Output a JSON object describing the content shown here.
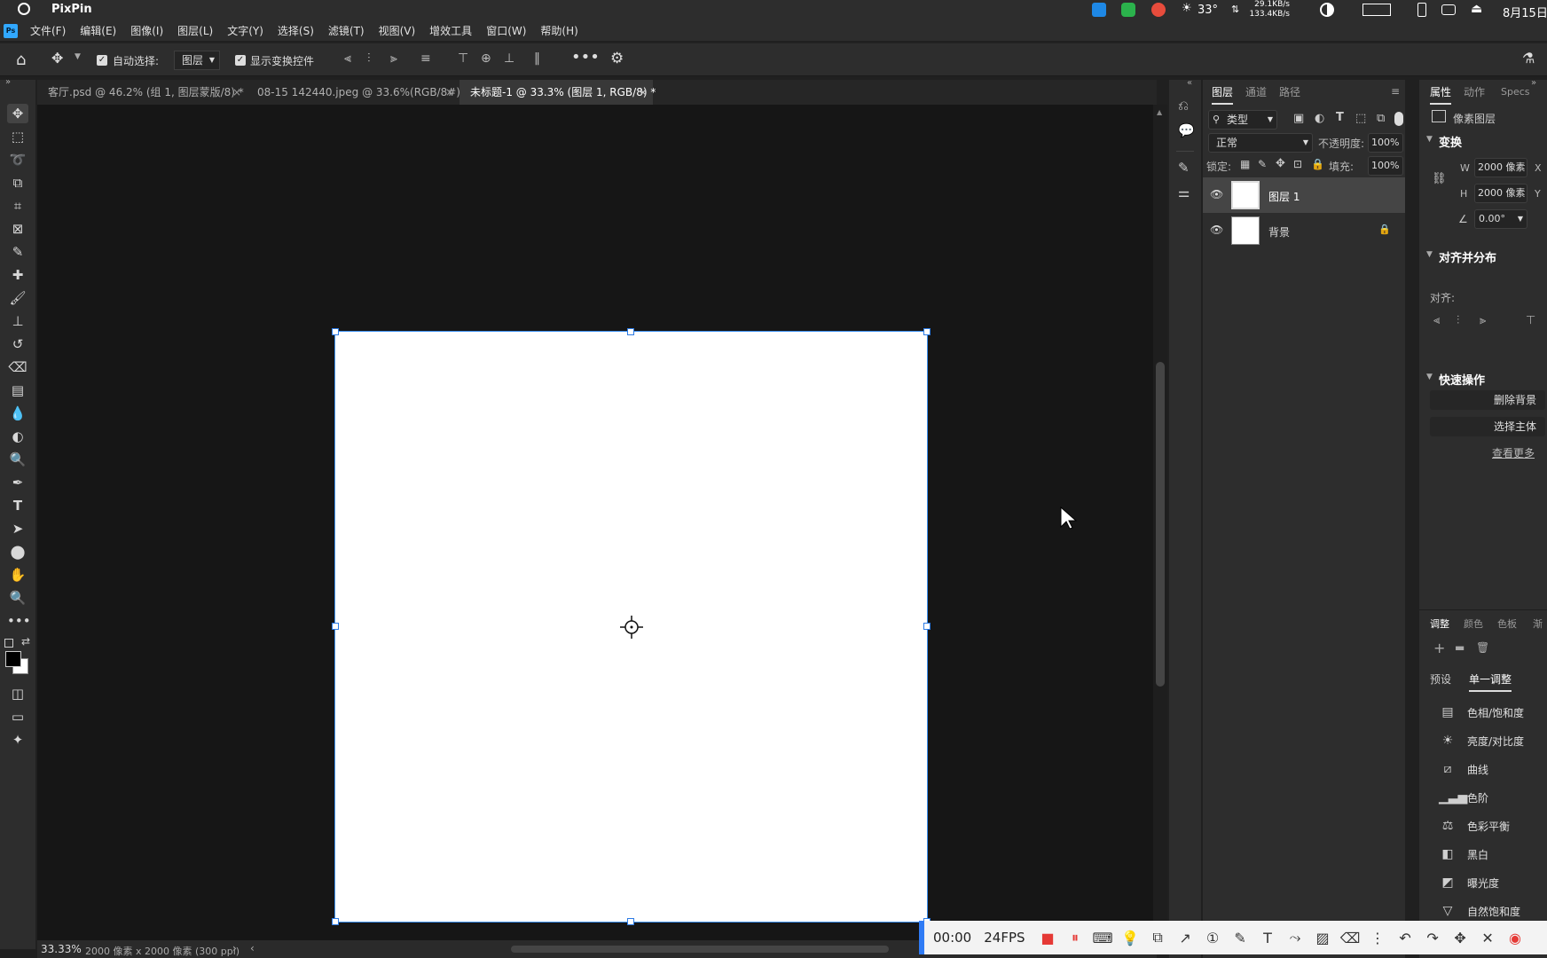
{
  "app_title": "PixPin",
  "system_tray": {
    "temperature": "33°",
    "net_up": "29.1KB/s",
    "net_down": "133.4KB/s",
    "date": "8月15日"
  },
  "menu": [
    "文件(F)",
    "编辑(E)",
    "图像(I)",
    "图层(L)",
    "文字(Y)",
    "选择(S)",
    "滤镜(T)",
    "视图(V)",
    "增效工具",
    "窗口(W)",
    "帮助(H)"
  ],
  "options": {
    "auto_select_label": "自动选择:",
    "auto_select_value": "图层",
    "show_transform_label": "显示变换控件"
  },
  "tabs": [
    {
      "label": "客厅.psd @ 46.2% (组 1, 图层蒙版/8) *"
    },
    {
      "label": "08-15 142440.jpeg @ 33.6%(RGB/8#) *"
    },
    {
      "label": "未标题-1 @ 33.3% (图层 1, RGB/8) *"
    }
  ],
  "status_bar": {
    "zoom": "33.33%",
    "doc_info": "2000 像素 x 2000 像素 (300 ppi)"
  },
  "layers_panel": {
    "tabs": [
      "图层",
      "通道",
      "路径"
    ],
    "filter_kind": "类型",
    "blend_mode": "正常",
    "opacity_label": "不透明度:",
    "opacity_value": "100%",
    "lock_label": "锁定:",
    "fill_label": "填充:",
    "fill_value": "100%",
    "layers": [
      {
        "name": "图层 1"
      },
      {
        "name": "背景"
      }
    ]
  },
  "properties_panel": {
    "tabs": [
      "属性",
      "动作",
      "Specs"
    ],
    "layer_type": "像素图层",
    "transform_title": "变换",
    "w_label": "W",
    "w_value": "2000 像素",
    "h_label": "H",
    "h_value": "2000 像素",
    "x_label": "X",
    "y_label": "Y",
    "angle_value": "0.00°",
    "align_title": "对齐并分布",
    "align_label": "对齐:",
    "quick_title": "快速操作",
    "remove_bg": "删除背景",
    "select_subject": "选择主体",
    "see_more": "查看更多"
  },
  "adjustments_panel": {
    "tabs": [
      "调整",
      "颜色",
      "色板",
      "渐"
    ],
    "subtabs": [
      "预设",
      "单一调整"
    ],
    "items": [
      "色相/饱和度",
      "亮度/对比度",
      "曲线",
      "色阶",
      "色彩平衡",
      "黑白",
      "曝光度",
      "自然饱和度"
    ]
  },
  "recorder": {
    "time": "00:00",
    "fps": "24FPS"
  }
}
